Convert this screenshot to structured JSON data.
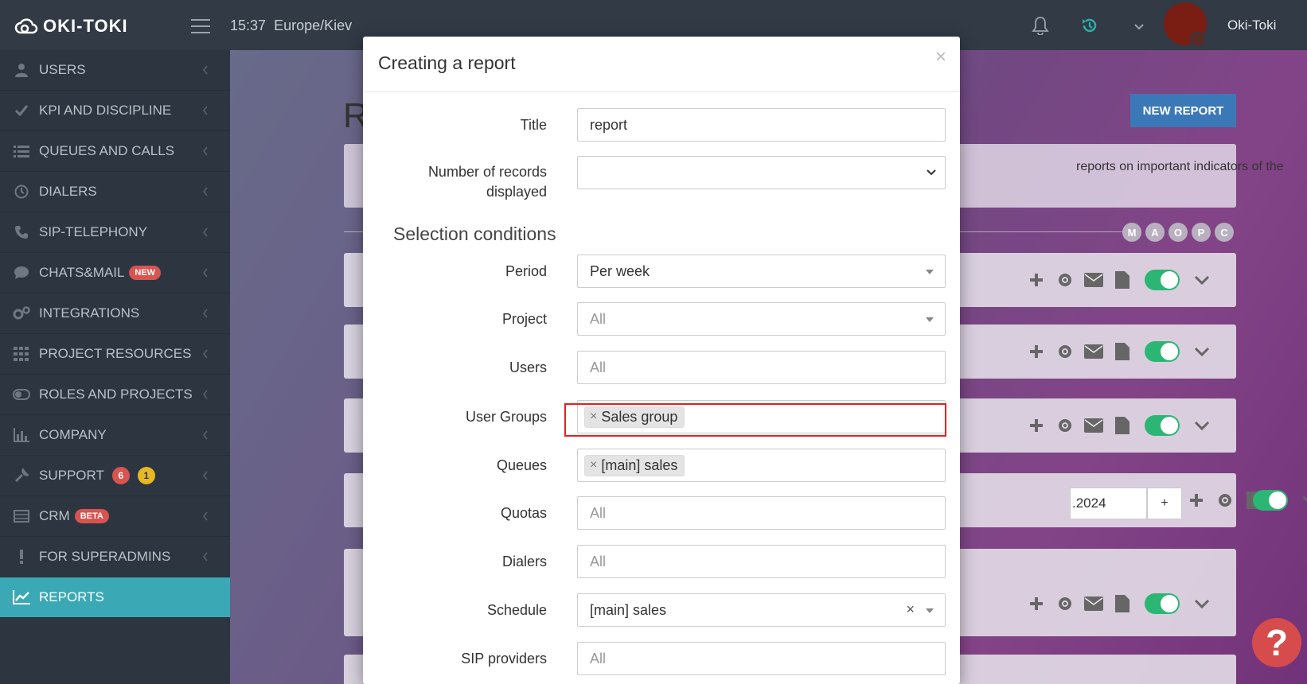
{
  "topbar": {
    "logo_text": "OKI-TOKI",
    "time": "15:37",
    "timezone": "Europe/Kiev",
    "username": "Oki-Toki"
  },
  "sidebar": {
    "items": [
      {
        "label": "USERS",
        "icon": "user-icon"
      },
      {
        "label": "KPI AND DISCIPLINE",
        "icon": "check-icon"
      },
      {
        "label": "QUEUES AND CALLS",
        "icon": "list-icon"
      },
      {
        "label": "DIALERS",
        "icon": "clock-icon"
      },
      {
        "label": "SIP-TELEPHONY",
        "icon": "phone-icon"
      },
      {
        "label": "CHATS&MAIL",
        "icon": "chat-icon",
        "badge": "NEW"
      },
      {
        "label": "INTEGRATIONS",
        "icon": "gears-icon"
      },
      {
        "label": "PROJECT RESOURCES",
        "icon": "grid-icon"
      },
      {
        "label": "ROLES AND PROJECTS",
        "icon": "toggle-icon"
      },
      {
        "label": "COMPANY",
        "icon": "bar-chart-icon"
      },
      {
        "label": "SUPPORT",
        "icon": "wrench-icon",
        "count_red": "6",
        "count_yellow": "1"
      },
      {
        "label": "CRM",
        "icon": "table-icon",
        "badge": "BETA"
      },
      {
        "label": "FOR SUPERADMINS",
        "icon": "exclamation-icon"
      },
      {
        "label": "REPORTS",
        "icon": "line-chart-icon",
        "active": true
      }
    ]
  },
  "background": {
    "page_title": "R",
    "new_report_label": "NEW REPORT",
    "info_text": "reports on important indicators of the",
    "letters": [
      "M",
      "A",
      "O",
      "P",
      "C"
    ],
    "date_value": ".2024",
    "plus_label": "+"
  },
  "modal": {
    "title": "Creating a report",
    "close_symbol": "×",
    "fields": {
      "title": {
        "label": "Title",
        "value": "report"
      },
      "records": {
        "label_line1": "Number of records",
        "label_line2": "displayed",
        "value": ""
      },
      "section": "Selection conditions",
      "period": {
        "label": "Period",
        "value": "Per week"
      },
      "project": {
        "label": "Project",
        "placeholder": "All"
      },
      "users": {
        "label": "Users",
        "placeholder": "All"
      },
      "user_groups": {
        "label": "User Groups",
        "tag": "Sales group"
      },
      "queues": {
        "label": "Queues",
        "tag": "[main] sales"
      },
      "quotas": {
        "label": "Quotas",
        "placeholder": "All"
      },
      "dialers": {
        "label": "Dialers",
        "placeholder": "All"
      },
      "schedule": {
        "label": "Schedule",
        "value": "[main] sales",
        "clear": "×"
      },
      "sip_providers": {
        "label": "SIP providers",
        "placeholder": "All"
      }
    },
    "tag_remove_symbol": "×"
  },
  "help_symbol": "?",
  "colors": {
    "sidebar_bg": "#2d3640",
    "active_item": "#3aa9b5",
    "primary_button": "#3b78b8",
    "toggle_on": "#2bb673",
    "highlight": "#e02020"
  }
}
